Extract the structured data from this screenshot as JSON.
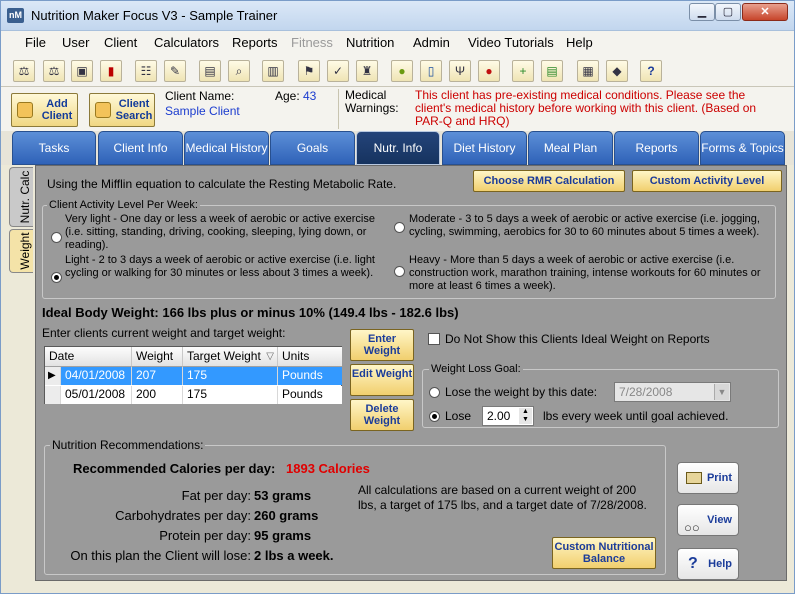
{
  "window": {
    "title": "Nutrition Maker Focus V3 - Sample Trainer",
    "icon_label": "nM",
    "min_glyph": "▁",
    "max_glyph": "▢",
    "close_glyph": "✕"
  },
  "menu": [
    "File",
    "User",
    "Client",
    "Calculators",
    "Reports",
    "Fitness",
    "Nutrition",
    "Admin",
    "Video Tutorials",
    "Help"
  ],
  "header": {
    "add_client": "Add Client",
    "client_search": "Client Search",
    "client_name_label": "Client Name:",
    "client_name": "Sample Client",
    "age_label": "Age:",
    "age": "43",
    "warnings_label": "Medical Warnings:",
    "warnings_text": "This client has pre-existing medical conditions. Please see the client's medical history before working with this client.  (Based on PAR-Q and HRQ)"
  },
  "tabs": [
    "Tasks",
    "Client Info",
    "Medical History",
    "Goals",
    "Nutr. Info",
    "Diet History",
    "Meal Plan",
    "Reports",
    "Forms & Topics"
  ],
  "side_tabs": [
    "Nutr. Calc",
    "Weight"
  ],
  "rmr": {
    "text": "Using the Mifflin equation to calculate the Resting Metabolic Rate.",
    "choose_button": "Choose RMR Calculation",
    "custom_button": "Custom Activity Level"
  },
  "activity": {
    "title": "Client Activity Level Per Week:",
    "options": [
      "Very light - One day or less a week of aerobic or active exercise (i.e. sitting, standing, driving, cooking, sleeping, lying down, or reading).",
      "Moderate - 3 to 5 days a week of aerobic or active exercise (i.e. jogging, cycling, swimming, aerobics for 30 to 60 minutes about 5 times a week).",
      "Light - 2 to 3 days a week of aerobic or active exercise (i.e. light cycling or walking for 30 minutes or less about 3 times a week).",
      "Heavy - More than 5 days a week of aerobic or active exercise (i.e. construction work, marathon training, intense workouts for 60 minutes or more at least 6 times a week)."
    ],
    "selected": 2
  },
  "ideal_weight": "Ideal Body Weight: 166 lbs plus or minus 10% (149.4 lbs - 182.6 lbs)",
  "weights": {
    "prompt": "Enter clients current weight and target weight:",
    "columns": [
      "Date",
      "Weight",
      "Target Weight",
      "Units"
    ],
    "sort_glyph": "▽",
    "row_marker": "▶",
    "rows": [
      {
        "date": "04/01/2008",
        "weight": "207",
        "target": "175",
        "units": "Pounds"
      },
      {
        "date": "05/01/2008",
        "weight": "200",
        "target": "175",
        "units": "Pounds"
      }
    ],
    "enter_button": "Enter Weight",
    "edit_button": "Edit Weight",
    "delete_button": "Delete Weight",
    "do_not_show": "Do Not Show this Clients Ideal Weight on Reports"
  },
  "goal": {
    "title": "Weight Loss Goal:",
    "by_date_label": "Lose the weight by this date:",
    "by_date_value": "7/28/2008",
    "lose_label": "Lose",
    "lose_value": "2.00",
    "lose_suffix": "lbs every week until goal achieved."
  },
  "recommendations": {
    "title": "Nutrition Recommendations:",
    "cal_label": "Recommended Calories per day:",
    "cal_value": "1893 Calories",
    "fat_label": "Fat per day:",
    "fat_value": "53 grams",
    "carb_label": "Carbohydrates per day:",
    "carb_value": "260 grams",
    "protein_label": "Protein per day:",
    "protein_value": "95 grams",
    "lose_label": "On this plan the Client will lose:",
    "lose_value": "2 lbs a week.",
    "note": "All calculations are based on a current weight of 200 lbs, a target of 175 lbs, and a target date of 7/28/2008.",
    "custom_button": "Custom Nutritional Balance",
    "print_button": "Print",
    "view_button": "View",
    "help_button": "Help",
    "help_glyph": "?"
  },
  "toolbar_glyphs": [
    "⚖",
    "⚖",
    "▣",
    "▮",
    "☷",
    "✎",
    "▤",
    "⌕",
    "▥",
    "⚑",
    "✓",
    "♜",
    "●",
    "▯",
    "Ψ",
    "●",
    "+",
    "▤",
    "▦",
    "◆",
    "?"
  ],
  "colors": {
    "accent": "#2f62b8",
    "warning": "#cc0000",
    "calories": "#e00000"
  }
}
